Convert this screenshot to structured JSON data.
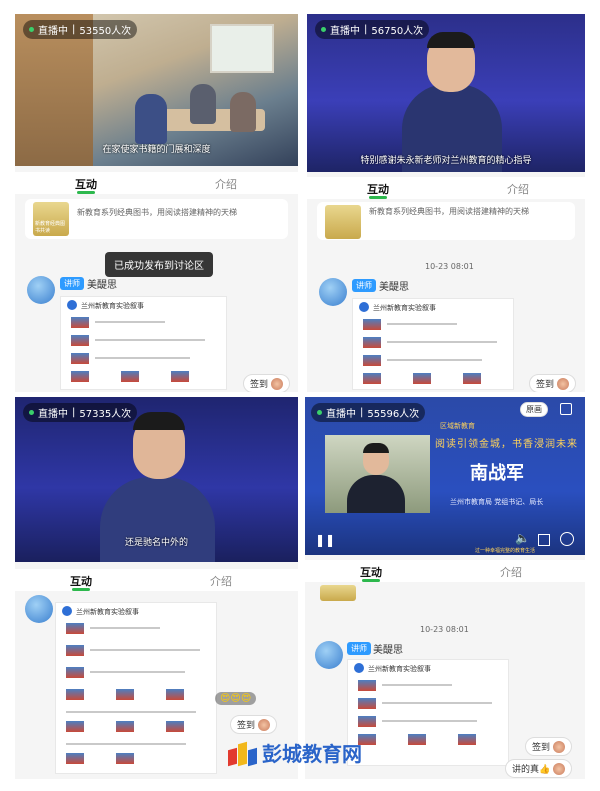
{
  "panels": [
    {
      "viewer_count": "53550人次",
      "live_label": "直播中",
      "subtitle": "在家使家书籍的门展和深度",
      "tabs": [
        "互动",
        "介绍"
      ],
      "book_text": "新教育系列经典图书，用阅读搭建精神的天梯",
      "book_thumb_text": "新教育经典图书共读",
      "toast": "已成功发布到讨论区",
      "lecturer_badge": "讲师",
      "lecturer_name": "美醍思",
      "doc_title": "兰州新教育实验叙事",
      "checkin": "签到"
    },
    {
      "viewer_count": "56750人次",
      "live_label": "直播中",
      "subtitle": "特别感谢朱永新老师对兰州教育的精心指导",
      "tabs": [
        "互动",
        "介绍"
      ],
      "book_text": "新教育系列经典图书，用阅读搭建精神的天梯",
      "timestamp": "10-23 08:01",
      "lecturer_badge": "讲师",
      "lecturer_name": "美醍思",
      "doc_title": "兰州新教育实验叙事",
      "checkin": "签到"
    },
    {
      "viewer_count": "57335人次",
      "live_label": "直播中",
      "subtitle": "还是驰名中外的",
      "tabs": [
        "互动",
        "介绍"
      ],
      "doc_title": "兰州新教育实验叙事",
      "emoji": "😍😍😍",
      "checkin": "签到"
    },
    {
      "viewer_count": "55596人次",
      "live_label": "直播中",
      "orig_button": "原画",
      "video_banner_small": "区域新教育",
      "video_banner_heading": "阅读引领金城，书香浸润未来",
      "speaker_name": "南战军",
      "speaker_title": "兰州市教育局  党组书记、局长",
      "footer_slogan": "过一种幸福完整的教育生活",
      "tabs": [
        "互动",
        "介绍"
      ],
      "timestamp": "10-23 08:01",
      "lecturer_badge": "讲师",
      "lecturer_name": "美醍思",
      "doc_title": "兰州新教育实验叙事",
      "checkin": "签到",
      "comment": "讲的真👍"
    }
  ],
  "watermark": "彭城教育网",
  "colors": {
    "accent_green": "#2db84d",
    "lecturer_blue": "#2e9bff",
    "stage_blue": "#233a8c",
    "watermark_blue": "#2a64c9"
  }
}
